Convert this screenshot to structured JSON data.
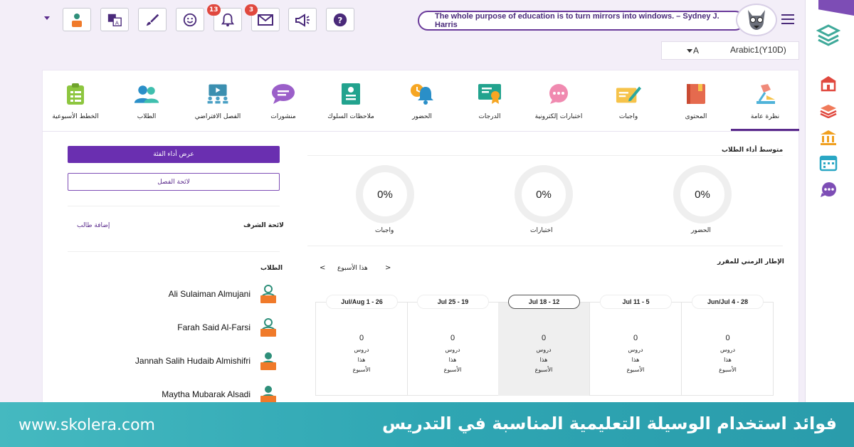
{
  "topbar": {
    "quote": "The whole purpose of education is to turn mirrors into windows. – Sydney J. Harris",
    "notifications_badge": "13",
    "messages_badge": "3"
  },
  "course": {
    "section": "A",
    "name": "Arabic1(Y10D)"
  },
  "nav": {
    "items": [
      {
        "label": "نظرة عامة"
      },
      {
        "label": "المحتوى"
      },
      {
        "label": "واجبات"
      },
      {
        "label": "اختبارات إلكترونية"
      },
      {
        "label": "الدرجات"
      },
      {
        "label": "الحضور"
      },
      {
        "label": "ملاحظات السلوك"
      },
      {
        "label": "منشورات"
      },
      {
        "label": "الفصل الافتراضي"
      },
      {
        "label": "الطلاب"
      },
      {
        "label": "الخطط الأسبوعية"
      }
    ]
  },
  "left": {
    "class_performance_button": "عرض أداء الفئة",
    "class_list_button": "لائحة الفصل",
    "honor_list": "لائحة الشرف",
    "add_student": "إضافة طالب",
    "students_heading": "الطلاب",
    "students": [
      {
        "name": "Ali Sulaiman Almujani"
      },
      {
        "name": "Farah Said Al-Farsi"
      },
      {
        "name": "Jannah Salih Hudaib Almishifri"
      },
      {
        "name": "Maytha Mubarak Alsadi"
      }
    ]
  },
  "performance": {
    "heading": "متوسط أداء الطلاب",
    "rings": [
      {
        "label": "الحضور",
        "value": "0%"
      },
      {
        "label": "اختبارات",
        "value": "0%"
      },
      {
        "label": "واجبات",
        "value": "0%"
      }
    ]
  },
  "timeline": {
    "heading": "الإطار الزمني للمقرر",
    "this_week": "هذا الأسبوع",
    "weeks": [
      {
        "range": "Jun/Jul 4 - 28",
        "count": "0",
        "l1": "دروس",
        "l2": "هذا",
        "l3": "الأسبوع"
      },
      {
        "range": "Jul 11 - 5",
        "count": "0",
        "l1": "دروس",
        "l2": "هذا",
        "l3": "الأسبوع"
      },
      {
        "range": "Jul 18 - 12",
        "count": "0",
        "l1": "دروس",
        "l2": "هذا",
        "l3": "الأسبوع"
      },
      {
        "range": "Jul 25 - 19",
        "count": "0",
        "l1": "دروس",
        "l2": "هذا",
        "l3": "الأسبوع"
      },
      {
        "range": "Jul/Aug 1 - 26",
        "count": "0",
        "l1": "دروس",
        "l2": "هذا",
        "l3": "الأسبوع"
      }
    ]
  },
  "footer": {
    "url": "www.skolera.com",
    "title": "فوائد استخدام الوسيلة التعليمية المناسبة في التدريس"
  },
  "colors": {
    "brand_purple": "#6a2fb0",
    "banner_teal": "#2fa6b3",
    "badge_red": "#e0483e"
  }
}
